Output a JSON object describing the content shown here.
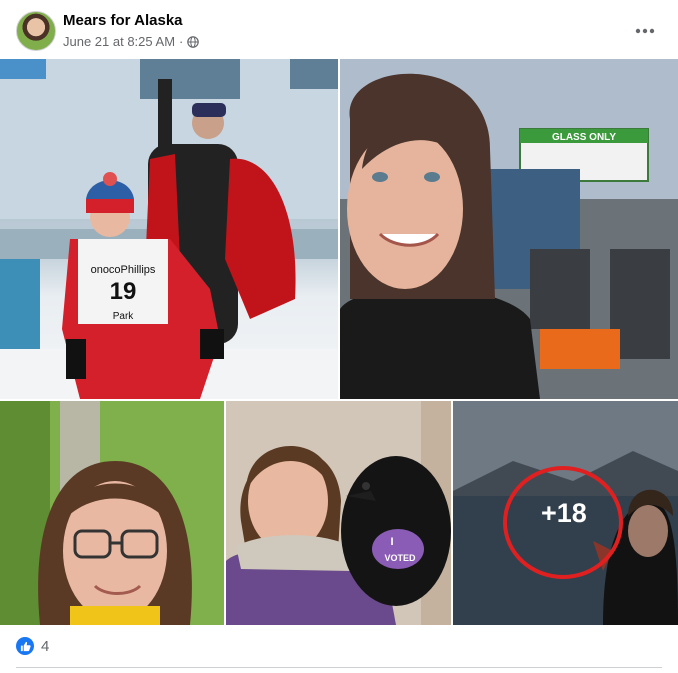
{
  "post": {
    "author": "Mears for Alaska",
    "date": "June 21 at 8:25 AM",
    "separator": "·",
    "privacy_icon": "globe-icon",
    "more_icon": "more-dots-icon"
  },
  "photos": {
    "p1": {
      "bib_sponsor": "onocoPhillips",
      "bib_number": "19",
      "bib_sub": "Park"
    },
    "p2": {
      "sign_text": "GLASS ONLY"
    },
    "p4": {
      "sticker_line1": "I",
      "sticker_line2": "VOTED"
    },
    "more_count": "+18"
  },
  "reactions": {
    "icon": "like-icon",
    "count": "4"
  },
  "colors": {
    "like_blue": "#1877f2",
    "highlight_red": "#e02020",
    "meta_gray": "#65676b"
  }
}
